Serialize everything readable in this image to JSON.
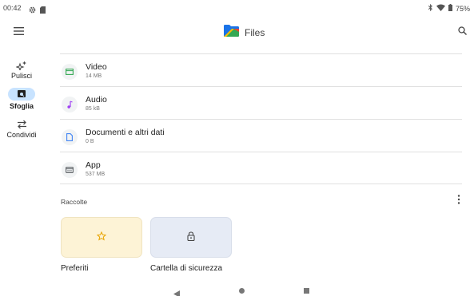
{
  "status_bar": {
    "time": "00:42",
    "left_icons": [
      "settings-icon",
      "sd-card-icon"
    ],
    "right_icons": [
      "bluetooth-icon",
      "wifi-icon",
      "battery-icon"
    ],
    "battery": "75%"
  },
  "app_bar": {
    "title": "Files",
    "menu_icon": "hamburger-menu-icon",
    "search_icon": "search-icon"
  },
  "nav_rail": {
    "items": [
      {
        "label": "Pulisci",
        "icon": "sparkle-icon",
        "active": false
      },
      {
        "label": "Sfoglia",
        "icon": "browse-folder-icon",
        "active": true
      },
      {
        "label": "Condividi",
        "icon": "swap-arrows-icon",
        "active": false
      }
    ]
  },
  "categories": [
    {
      "name": "Video",
      "size": "14 MB",
      "icon": "video-icon"
    },
    {
      "name": "Audio",
      "size": "85 kB",
      "icon": "music-note-icon"
    },
    {
      "name": "Documenti e altri dati",
      "size": "0 B",
      "icon": "document-icon"
    },
    {
      "name": "App",
      "size": "537 MB",
      "icon": "app-icon"
    }
  ],
  "collections": {
    "title": "Raccolte",
    "items": [
      {
        "label": "Preferiti",
        "icon": "star-icon"
      },
      {
        "label": "Cartella di sicurezza",
        "icon": "lock-icon"
      }
    ]
  },
  "colors": {
    "accent": "#1a73e8",
    "nav_active_bg": "#c8e3ff",
    "favorites_card_bg": "#fdf3d6",
    "safe_folder_card_bg": "#e6ebf5",
    "video_icon": "#34a853",
    "audio_icon": "#a142f4",
    "document_icon": "#4285f4",
    "app_icon": "#5f6368",
    "star_icon": "#e8a400"
  }
}
